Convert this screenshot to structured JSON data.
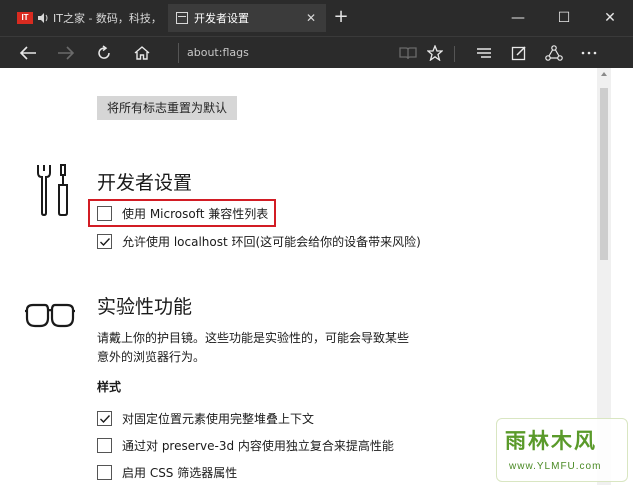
{
  "tabs": [
    {
      "label": "IT之家 - 数码，科技，生",
      "favicon": "IT",
      "audio_icon": "speaker-icon",
      "active": false
    },
    {
      "label": "开发者设置",
      "active": true
    }
  ],
  "window_controls": {
    "minimize": "—",
    "maximize": "☐",
    "close": "✕"
  },
  "navbar": {
    "address": "about:flags"
  },
  "reset_button": "将所有标志重置为默认",
  "developer_section": {
    "title": "开发者设置",
    "icon": "tools-icon",
    "options": [
      {
        "label": "使用 Microsoft 兼容性列表",
        "checked": false
      },
      {
        "label": "允许使用 localhost 环回(这可能会给你的设备带来风险)",
        "checked": true
      }
    ]
  },
  "experimental_section": {
    "title": "实验性功能",
    "icon": "goggles-icon",
    "description_line1": "请戴上你的护目镜。这些功能是实验性的，可能会导致某些",
    "description_line2": "意外的浏览器行为。",
    "subheading": "样式",
    "options": [
      {
        "label": "对固定位置元素使用完整堆叠上下文",
        "checked": true
      },
      {
        "label": "通过对 preserve-3d 内容使用独立复合来提高性能",
        "checked": false
      },
      {
        "label": "启用 CSS 筛选器属性",
        "checked": false
      }
    ]
  },
  "watermark": {
    "logo": "雨林木风",
    "url": "www.YLMFU.com"
  },
  "colors": {
    "chrome": "#2b2b2b",
    "active_tab": "#3b3b3b",
    "highlight": "#d21c24",
    "button": "#d6d6d6"
  }
}
